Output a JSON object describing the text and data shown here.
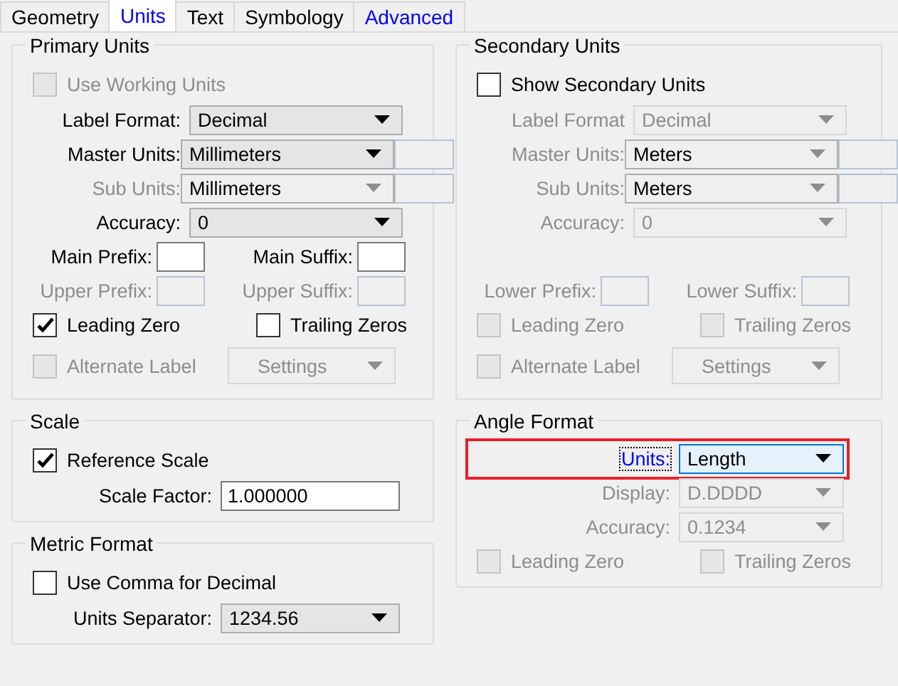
{
  "tabs": [
    {
      "label": "Geometry",
      "selected": false,
      "link": false
    },
    {
      "label": "Units",
      "selected": true,
      "link": true
    },
    {
      "label": "Text",
      "selected": false,
      "link": false
    },
    {
      "label": "Symbology",
      "selected": false,
      "link": false
    },
    {
      "label": "Advanced",
      "selected": false,
      "link": true
    }
  ],
  "primary_units": {
    "title": "Primary Units",
    "rows": [
      {
        "kind": "check",
        "label": "Use Working Units",
        "checked": false,
        "disabled": true
      },
      {
        "kind": "select",
        "label": "Label Format:",
        "label_disabled": false,
        "value": "Decimal",
        "disabled": false,
        "locked": false,
        "focused": false,
        "has_box": false
      },
      {
        "kind": "select",
        "label": "Master Units:",
        "label_disabled": false,
        "value": "Millimeters",
        "disabled": false,
        "locked": false,
        "focused": false,
        "has_box": true
      },
      {
        "kind": "select",
        "label": "Sub Units:",
        "label_disabled": true,
        "value": "Millimeters",
        "disabled": false,
        "locked": true,
        "focused": false,
        "has_box": true
      },
      {
        "kind": "select",
        "label": "Accuracy:",
        "label_disabled": false,
        "value": "0",
        "disabled": false,
        "locked": false,
        "focused": false,
        "has_box": false
      },
      {
        "kind": "pair",
        "fields": [
          {
            "label": "Main Prefix:",
            "disabled": false
          },
          {
            "label": "Main Suffix:",
            "disabled": false
          }
        ]
      },
      {
        "kind": "pair",
        "fields": [
          {
            "label": "Upper Prefix:",
            "disabled": true
          },
          {
            "label": "Upper Suffix:",
            "disabled": true
          }
        ]
      },
      {
        "kind": "check-pair",
        "checks": [
          {
            "label": "Leading Zero",
            "checked": true,
            "disabled": false
          },
          {
            "label": "Trailing Zeros",
            "checked": false,
            "disabled": false
          }
        ]
      },
      {
        "kind": "check-button",
        "check": {
          "label": "Alternate Label",
          "checked": false,
          "disabled": true
        },
        "button": {
          "label": "Settings",
          "disabled": true
        }
      }
    ]
  },
  "secondary_units": {
    "title": "Secondary Units",
    "rows": [
      {
        "kind": "check",
        "label": "Show Secondary Units",
        "checked": false,
        "disabled": false
      },
      {
        "kind": "select",
        "label": "Label Format",
        "label_disabled": true,
        "value": "Decimal",
        "disabled": true,
        "locked": true,
        "focused": false,
        "has_box": false
      },
      {
        "kind": "select",
        "label": "Master Units:",
        "label_disabled": true,
        "value": "Meters",
        "disabled": false,
        "locked": true,
        "focused": false,
        "has_box": true
      },
      {
        "kind": "select",
        "label": "Sub Units:",
        "label_disabled": true,
        "value": "Meters",
        "disabled": false,
        "locked": true,
        "focused": false,
        "has_box": true
      },
      {
        "kind": "select",
        "label": "Accuracy:",
        "label_disabled": true,
        "value": "0",
        "disabled": true,
        "locked": true,
        "focused": false,
        "has_box": false
      },
      {
        "kind": "spacer"
      },
      {
        "kind": "pair",
        "fields": [
          {
            "label": "Lower Prefix:",
            "disabled": true
          },
          {
            "label": "Lower Suffix:",
            "disabled": true
          }
        ]
      },
      {
        "kind": "check-pair",
        "checks": [
          {
            "label": "Leading Zero",
            "checked": false,
            "disabled": true
          },
          {
            "label": "Trailing Zeros",
            "checked": false,
            "disabled": true
          }
        ]
      },
      {
        "kind": "check-button",
        "check": {
          "label": "Alternate Label",
          "checked": false,
          "disabled": true
        },
        "button": {
          "label": "Settings",
          "disabled": true
        }
      }
    ]
  },
  "scale": {
    "title": "Scale",
    "rows": [
      {
        "kind": "check",
        "label": "Reference Scale",
        "checked": true,
        "disabled": false
      },
      {
        "kind": "text",
        "label": "Scale Factor:",
        "value": "1.000000"
      }
    ]
  },
  "angle_format": {
    "title": "Angle Format",
    "rows": [
      {
        "kind": "select",
        "label": "Units:",
        "label_disabled": false,
        "value": "Length",
        "disabled": false,
        "locked": false,
        "focused": true,
        "has_box": false,
        "highlighted": true
      },
      {
        "kind": "select",
        "label": "Display:",
        "label_disabled": true,
        "value": "D.DDDD",
        "disabled": true,
        "locked": true,
        "focused": false,
        "has_box": false
      },
      {
        "kind": "select",
        "label": "Accuracy:",
        "label_disabled": true,
        "value": "0.1234",
        "disabled": true,
        "locked": true,
        "focused": false,
        "has_box": false
      },
      {
        "kind": "check-pair",
        "checks": [
          {
            "label": "Leading Zero",
            "checked": false,
            "disabled": true
          },
          {
            "label": "Trailing Zeros",
            "checked": false,
            "disabled": true
          }
        ]
      }
    ]
  },
  "metric_format": {
    "title": "Metric Format",
    "rows": [
      {
        "kind": "check",
        "label": "Use Comma for Decimal",
        "checked": false,
        "disabled": false
      },
      {
        "kind": "select",
        "label": "Units Separator:",
        "label_disabled": false,
        "value": "1234.56",
        "disabled": false,
        "locked": false,
        "focused": false,
        "has_box": false
      }
    ]
  }
}
